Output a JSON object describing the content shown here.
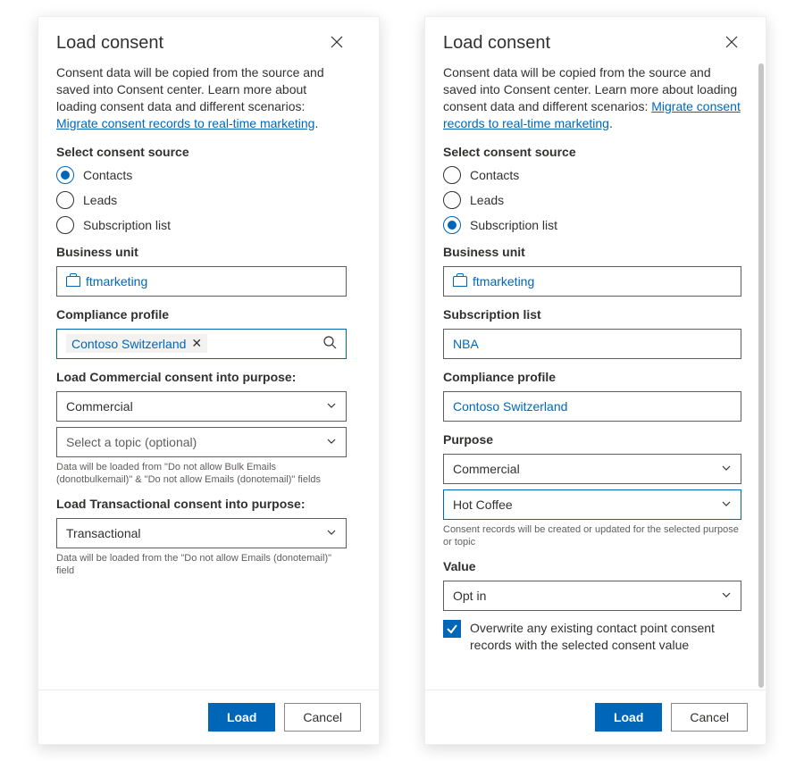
{
  "panelA": {
    "title": "Load consent",
    "intro_prefix": "Consent data will be copied from the source and saved into Consent center. Learn more about loading consent data and different scenarios: ",
    "intro_link": "Migrate consent records to real-time marketing",
    "intro_suffix": ".",
    "source_label": "Select consent source",
    "radios": {
      "contacts": "Contacts",
      "leads": "Leads",
      "subs": "Subscription list"
    },
    "bu_label": "Business unit",
    "bu_value": "ftmarketing",
    "cp_label": "Compliance profile",
    "cp_value": "Contoso Switzerland",
    "commercial_label": "Load Commercial consent into purpose:",
    "commercial_value": "Commercial",
    "topic_placeholder": "Select a topic (optional)",
    "commercial_help": "Data will be loaded from \"Do not allow Bulk Emails (donotbulkemail)\" & \"Do not allow Emails (donotemail)\" fields",
    "trans_label": "Load Transactional consent into purpose:",
    "trans_value": "Transactional",
    "trans_help": "Data will be loaded from the \"Do not allow Emails (donotemail)\" field",
    "load_btn": "Load",
    "cancel_btn": "Cancel"
  },
  "panelB": {
    "title": "Load consent",
    "intro_prefix": "Consent data will be copied from the source and saved into Consent center. Learn more about loading consent data and different scenarios: ",
    "intro_link": "Migrate consent records to real-time marketing",
    "intro_suffix": ".",
    "source_label": "Select consent source",
    "radios": {
      "contacts": "Contacts",
      "leads": "Leads",
      "subs": "Subscription list"
    },
    "bu_label": "Business unit",
    "bu_value": "ftmarketing",
    "sl_label": "Subscription list",
    "sl_value": "NBA",
    "cp_label": "Compliance profile",
    "cp_value": "Contoso Switzerland",
    "purpose_label": "Purpose",
    "purpose_value": "Commercial",
    "topic_value": "Hot Coffee",
    "purpose_help": "Consent records will be created or updated for the selected purpose or topic",
    "value_label": "Value",
    "value_value": "Opt in",
    "overwrite_label": "Overwrite any existing contact point consent records with the selected consent value",
    "load_btn": "Load",
    "cancel_btn": "Cancel"
  }
}
